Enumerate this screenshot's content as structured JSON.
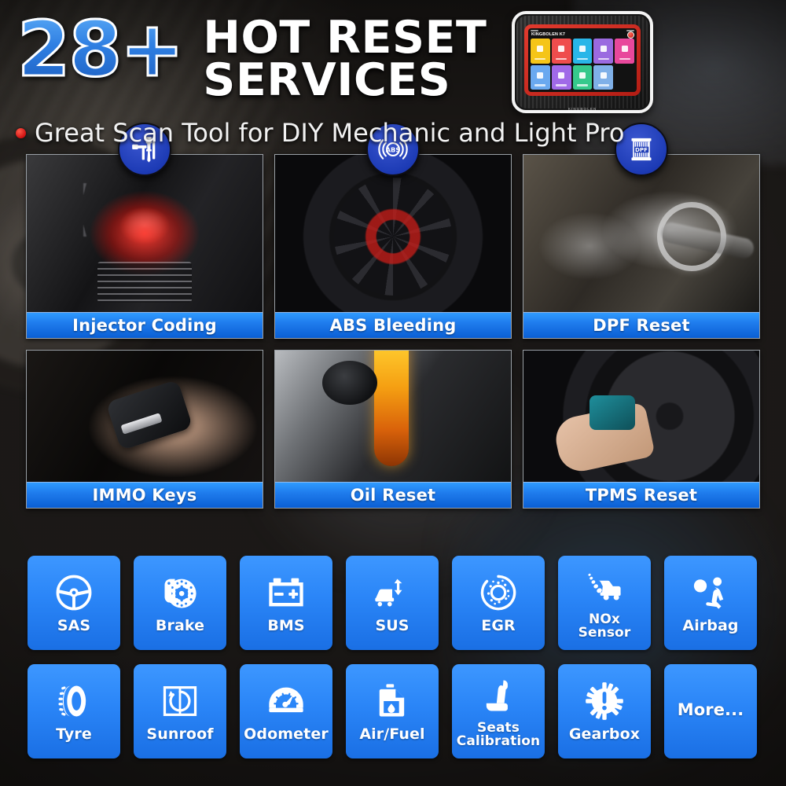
{
  "header": {
    "big_number": "28+",
    "headline_line1": "HOT RESET",
    "headline_line2": "SERVICES",
    "subtitle": "Great Scan Tool for DIY Mechanic and Light Pro",
    "bullet_color": "#cf1111",
    "number_color": "#2f7fe2"
  },
  "tablet": {
    "brand": "KINGBOLEN K7",
    "footer_brand": "KINGBOLEN",
    "apps": [
      {
        "name": "Scan",
        "color": "#f5c518"
      },
      {
        "name": "OBD",
        "color": "#ef4d4d"
      },
      {
        "name": "Data",
        "color": "#29b6e8"
      },
      {
        "name": "Reset",
        "color": "#9b6ae0"
      },
      {
        "name": "Repair Info",
        "color": "#e8489c"
      },
      {
        "name": "Update",
        "color": "#6aa9f0"
      },
      {
        "name": "Module",
        "color": "#a06ae8"
      },
      {
        "name": "File",
        "color": "#36c98c"
      },
      {
        "name": "Settings",
        "color": "#7fb0e8"
      }
    ]
  },
  "feature_cards": [
    {
      "label": "Injector Coding",
      "icon": "injector-icon",
      "photo": "engine-combustion-photo",
      "has_badge": true
    },
    {
      "label": "ABS Bleeding",
      "icon": "abs-icon",
      "photo": "wheel-brake-photo",
      "has_badge": true
    },
    {
      "label": "DPF Reset",
      "icon": "dpf-icon",
      "photo": "exhaust-smoke-photo",
      "has_badge": true
    },
    {
      "label": "IMMO Keys",
      "icon": null,
      "photo": "car-key-fob-photo",
      "has_badge": false
    },
    {
      "label": "Oil Reset",
      "icon": null,
      "photo": "oil-pouring-photo",
      "has_badge": false
    },
    {
      "label": "TPMS Reset",
      "icon": null,
      "photo": "tpms-tool-wheel-photo",
      "has_badge": false
    }
  ],
  "service_tiles": [
    {
      "label": "SAS",
      "icon": "steering-wheel-icon"
    },
    {
      "label": "Brake",
      "icon": "brake-disc-icon"
    },
    {
      "label": "BMS",
      "icon": "battery-icon"
    },
    {
      "label": "SUS",
      "icon": "suspension-car-icon"
    },
    {
      "label": "EGR",
      "icon": "egr-valve-icon"
    },
    {
      "label": "NOx\nSensor",
      "icon": "nox-sensor-truck-icon"
    },
    {
      "label": "Airbag",
      "icon": "airbag-seat-person-icon"
    },
    {
      "label": "Tyre",
      "icon": "tyre-icon"
    },
    {
      "label": "Sunroof",
      "icon": "sunroof-icon"
    },
    {
      "label": "Odometer",
      "icon": "odometer-gauge-icon"
    },
    {
      "label": "Air/Fuel",
      "icon": "fuel-can-icon"
    },
    {
      "label": "Seats\nCalibration",
      "icon": "car-seat-icon"
    },
    {
      "label": "Gearbox",
      "icon": "gear-warning-icon"
    },
    {
      "label": "More...",
      "icon": null
    }
  ],
  "colors": {
    "accent_blue": "#2a85f7",
    "label_bar_blue": "#1f7ced",
    "badge_blue": "#1d3bb5",
    "background_dark": "#2a2724"
  }
}
